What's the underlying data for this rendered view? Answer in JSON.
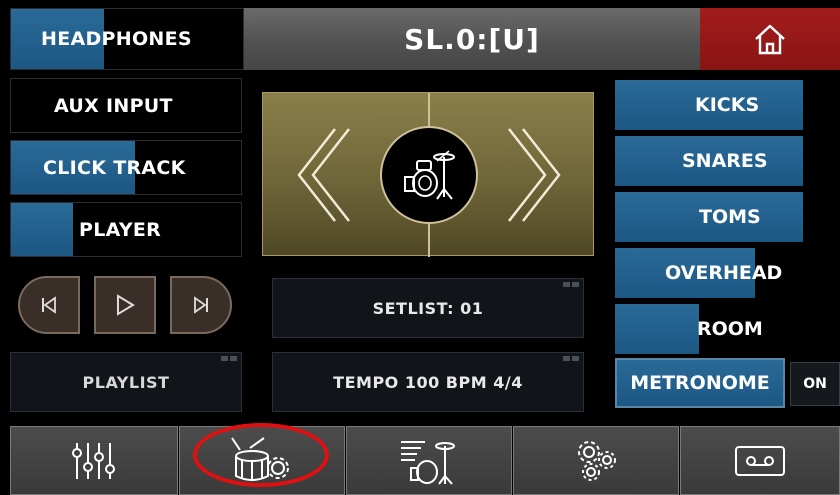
{
  "header": {
    "headphones_label": "HEADPHONES",
    "headphones_level": 0.4,
    "title": "SL.0:[U]",
    "home_icon": "home-icon"
  },
  "left_column": {
    "aux_input": {
      "label": "AUX INPUT",
      "level": 0.0
    },
    "click_track": {
      "label": "CLICK TRACK",
      "level": 0.54
    },
    "player": {
      "label": "PLAYER",
      "level": 0.27
    },
    "playlist_label": "PLAYLIST"
  },
  "transport": {
    "prev_icon": "skip-previous-icon",
    "play_icon": "play-icon",
    "next_icon": "skip-next-icon"
  },
  "center": {
    "kit_icon": "drum-kit-icon",
    "setlist_label": "SETLIST: 01",
    "tempo_label": "TEMPO 100 BPM 4/4"
  },
  "right_column": {
    "channels": [
      {
        "label": "KICKS",
        "level": 0.83
      },
      {
        "label": "SNARES",
        "level": 0.83
      },
      {
        "label": "TOMS",
        "level": 0.83
      },
      {
        "label": "OVERHEAD",
        "level": 0.62
      },
      {
        "label": "ROOM",
        "level": 0.37
      }
    ],
    "metronome_label": "METRONOME",
    "metronome_toggle": "ON"
  },
  "bottom_tabs": [
    {
      "icon": "mixer-sliders-icon"
    },
    {
      "icon": "drum-settings-icon"
    },
    {
      "icon": "drum-list-icon"
    },
    {
      "icon": "gears-icon"
    },
    {
      "icon": "cassette-icon"
    }
  ],
  "colors": {
    "accent_blue": "#1d5784",
    "home_red": "#8a1414",
    "kit_gold": "#6e6538",
    "highlight_red": "#e01010"
  }
}
